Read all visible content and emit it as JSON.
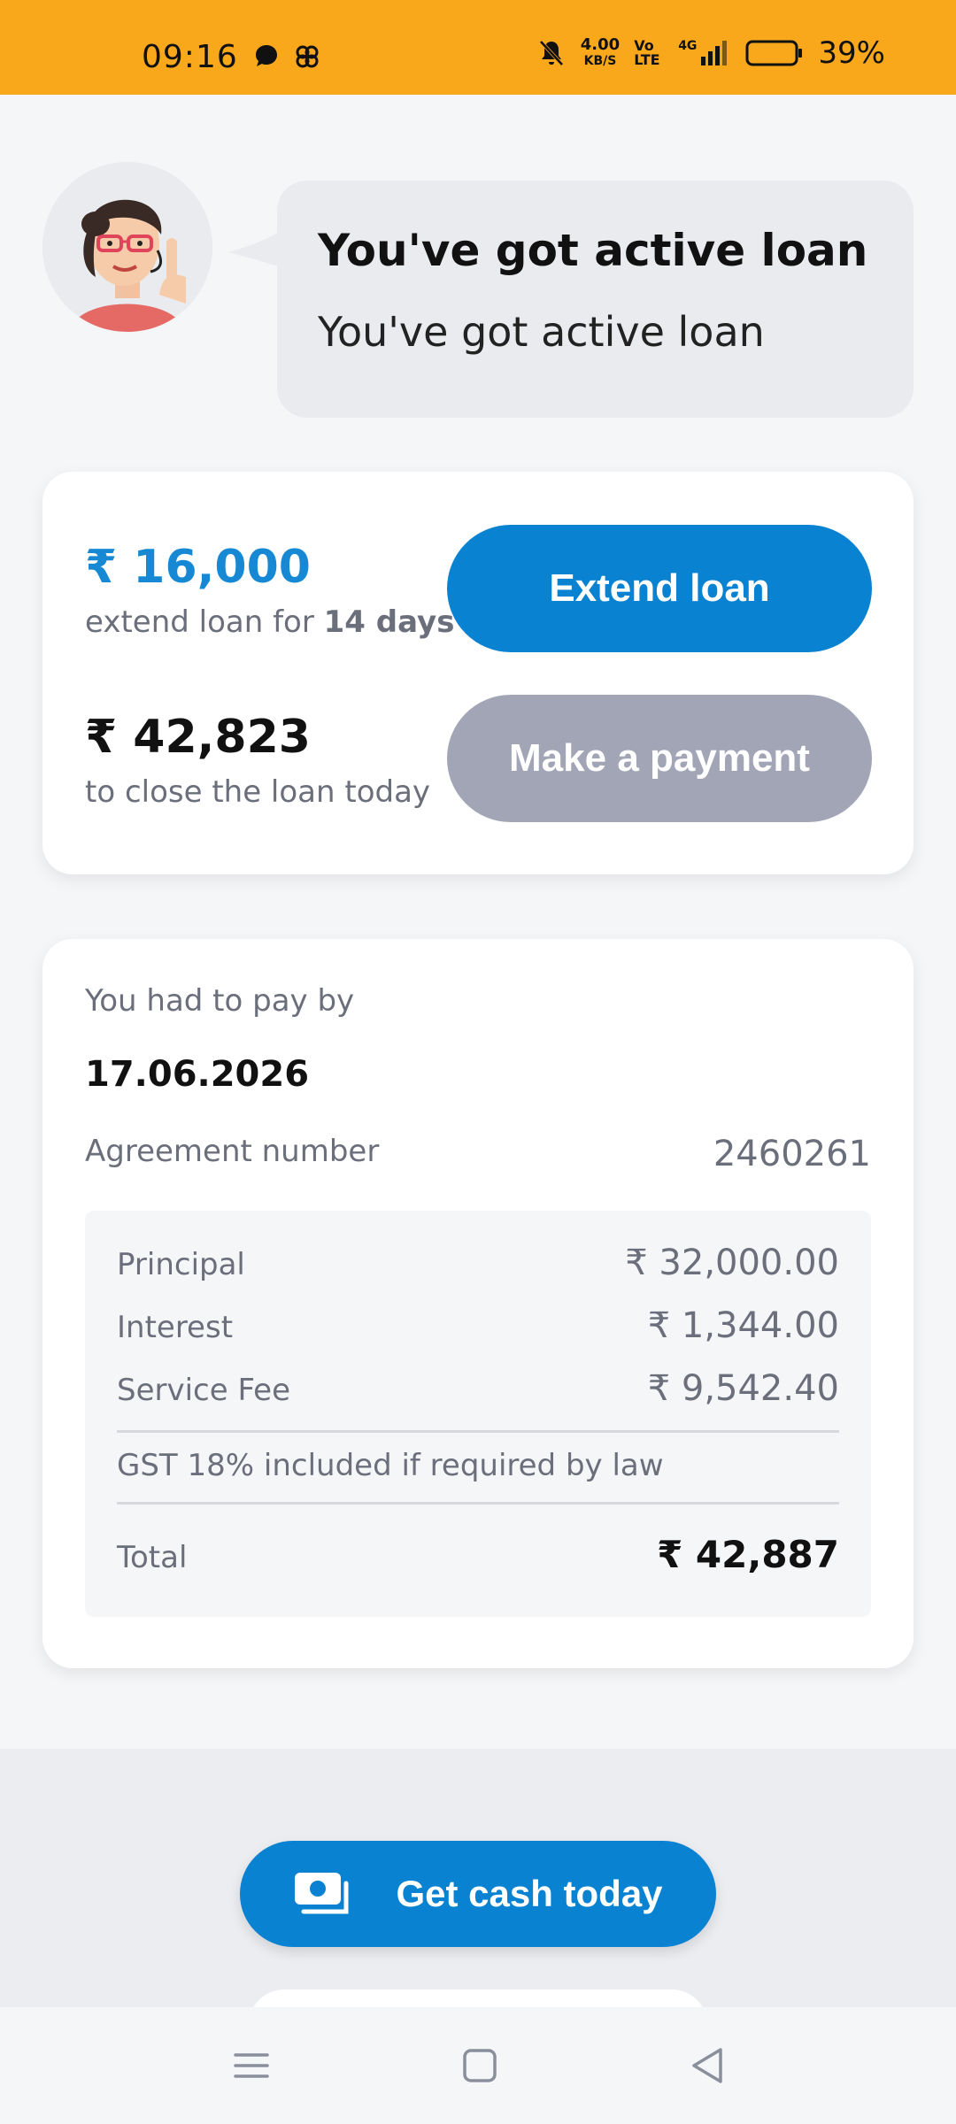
{
  "status_bar": {
    "time": "09:16",
    "net_speed": "4.00",
    "net_speed_unit": "KB/S",
    "volte": "Vo LTE",
    "network": "4G",
    "battery": "39%"
  },
  "chat": {
    "title": "You've got active loan",
    "text": "You've got active loan"
  },
  "loan_card": {
    "extend_amount": "₹ 16,000",
    "extend_prefix": "extend loan for ",
    "extend_days": "14 days",
    "extend_button": "Extend loan",
    "close_amount": "₹ 42,823",
    "close_text": "to close the loan today",
    "pay_button": "Make a payment"
  },
  "details": {
    "pay_by_label": "You had to pay by",
    "pay_by_date": "17.06.2026",
    "agreement_label": "Agreement number",
    "agreement_number": "2460261",
    "rows": [
      {
        "label": "Principal",
        "value": "₹ 32,000.00"
      },
      {
        "label": "Interest",
        "value": "₹ 1,344.00"
      },
      {
        "label": "Service Fee",
        "value": "₹ 9,542.40"
      }
    ],
    "gst_note": "GST 18% included if required by law",
    "total_label": "Total",
    "total_value": "₹ 42,887"
  },
  "cta": {
    "label": "Get cash today"
  },
  "colors": {
    "status_bar": "#f9a81c",
    "primary": "#0a82d2",
    "accent_amount": "#1789d4",
    "disabled_button": "#a1a5b6"
  },
  "icons": [
    "whatsapp-icon",
    "pinwheel-icon",
    "mute-bell-icon",
    "signal-icon",
    "battery-icon",
    "cash-icon",
    "menu-nav-icon",
    "home-nav-icon",
    "back-nav-icon"
  ]
}
